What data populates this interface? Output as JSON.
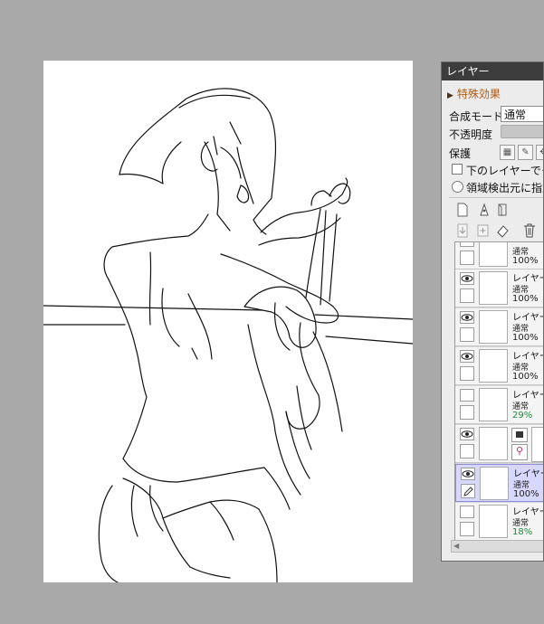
{
  "panel": {
    "title": "レイヤー",
    "effects_label": "特殊効果",
    "blend_mode_label": "合成モード",
    "blend_mode_value": "通常",
    "opacity_label": "不透明度",
    "protect_label": "保護",
    "clip_label": "下のレイヤーでクリ",
    "area_label": "領域検出元に指定"
  },
  "layers": [
    {
      "name": "",
      "mode": "通常",
      "opacity": "100%",
      "visible": false,
      "selected": false,
      "opacity_color": "#222222"
    },
    {
      "name": "レイヤー",
      "mode": "通常",
      "opacity": "100%",
      "visible": true,
      "selected": false,
      "opacity_color": "#222222"
    },
    {
      "name": "レイヤー",
      "mode": "通常",
      "opacity": "100%",
      "visible": true,
      "selected": false,
      "opacity_color": "#222222"
    },
    {
      "name": "レイヤー",
      "mode": "通常",
      "opacity": "100%",
      "visible": true,
      "selected": false,
      "opacity_color": "#222222"
    },
    {
      "name": "レイヤー",
      "mode": "通常",
      "opacity": "29%",
      "visible": false,
      "selected": false,
      "opacity_color": "#1a8a3a"
    },
    {
      "name": "",
      "mode": "",
      "opacity": "",
      "visible": true,
      "selected": false,
      "opacity_color": "#222222"
    },
    {
      "name": "レイヤー",
      "mode": "通常",
      "opacity": "100%",
      "visible": true,
      "selected": true,
      "opacity_color": "#222222"
    },
    {
      "name": "レイヤー",
      "mode": "通常",
      "opacity": "18%",
      "visible": false,
      "selected": false,
      "opacity_color": "#1a8a3a"
    }
  ],
  "colors": {
    "workspace": "#a9a9a9",
    "panel_title_bg": "#3c3c3c",
    "selected_layer": "#d7d8ff",
    "low_opacity_text": "#1a8a3a"
  }
}
